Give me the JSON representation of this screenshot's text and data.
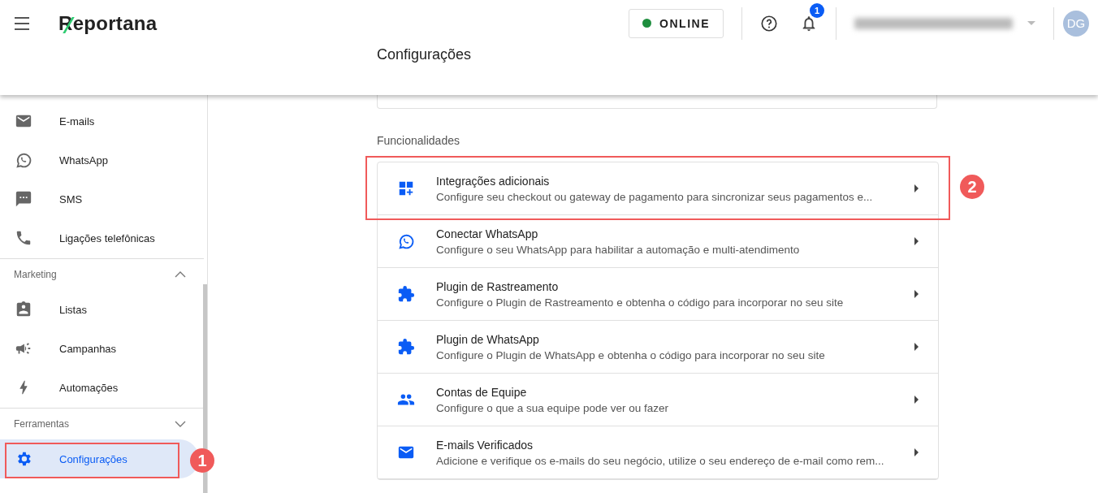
{
  "header": {
    "logo": "Reportana",
    "status": "ONLINE",
    "notification_count": "1",
    "avatar": "DG",
    "page_title": "Configurações"
  },
  "sidebar": {
    "groups": [
      {
        "items": [
          {
            "label": "E-mails",
            "selected": false
          },
          {
            "label": "WhatsApp",
            "selected": false
          },
          {
            "label": "SMS",
            "selected": false
          },
          {
            "label": "Ligações telefônicas",
            "selected": false
          }
        ]
      },
      {
        "title": "Marketing",
        "expanded": true,
        "items": [
          {
            "label": "Listas",
            "selected": false
          },
          {
            "label": "Campanhas",
            "selected": false
          },
          {
            "label": "Automações",
            "selected": false
          }
        ]
      },
      {
        "title": "Ferramentas",
        "expanded": false,
        "items": [
          {
            "label": "Configurações",
            "selected": true
          }
        ]
      }
    ]
  },
  "section_title": "Funcionalidades",
  "features": [
    {
      "title": "Integrações adicionais",
      "description": "Configure seu checkout ou gateway de pagamento para sincronizar seus pagamentos e..."
    },
    {
      "title": "Conectar WhatsApp",
      "description": "Configure o seu WhatsApp para habilitar a automação e multi-atendimento"
    },
    {
      "title": "Plugin de Rastreamento",
      "description": "Configure o Plugin de Rastreamento e obtenha o código para incorporar no seu site"
    },
    {
      "title": "Plugin de WhatsApp",
      "description": "Configure o Plugin de WhatsApp e obtenha o código para incorporar no seu site"
    },
    {
      "title": "Contas de Equipe",
      "description": "Configure o que a sua equipe pode ver ou fazer"
    },
    {
      "title": "E-mails Verificados",
      "description": "Adicione e verifique os e-mails do seu negócio, utilize o seu endereço de e-mail como rem..."
    }
  ],
  "annotations": [
    {
      "label": "1"
    },
    {
      "label": "2"
    }
  ]
}
